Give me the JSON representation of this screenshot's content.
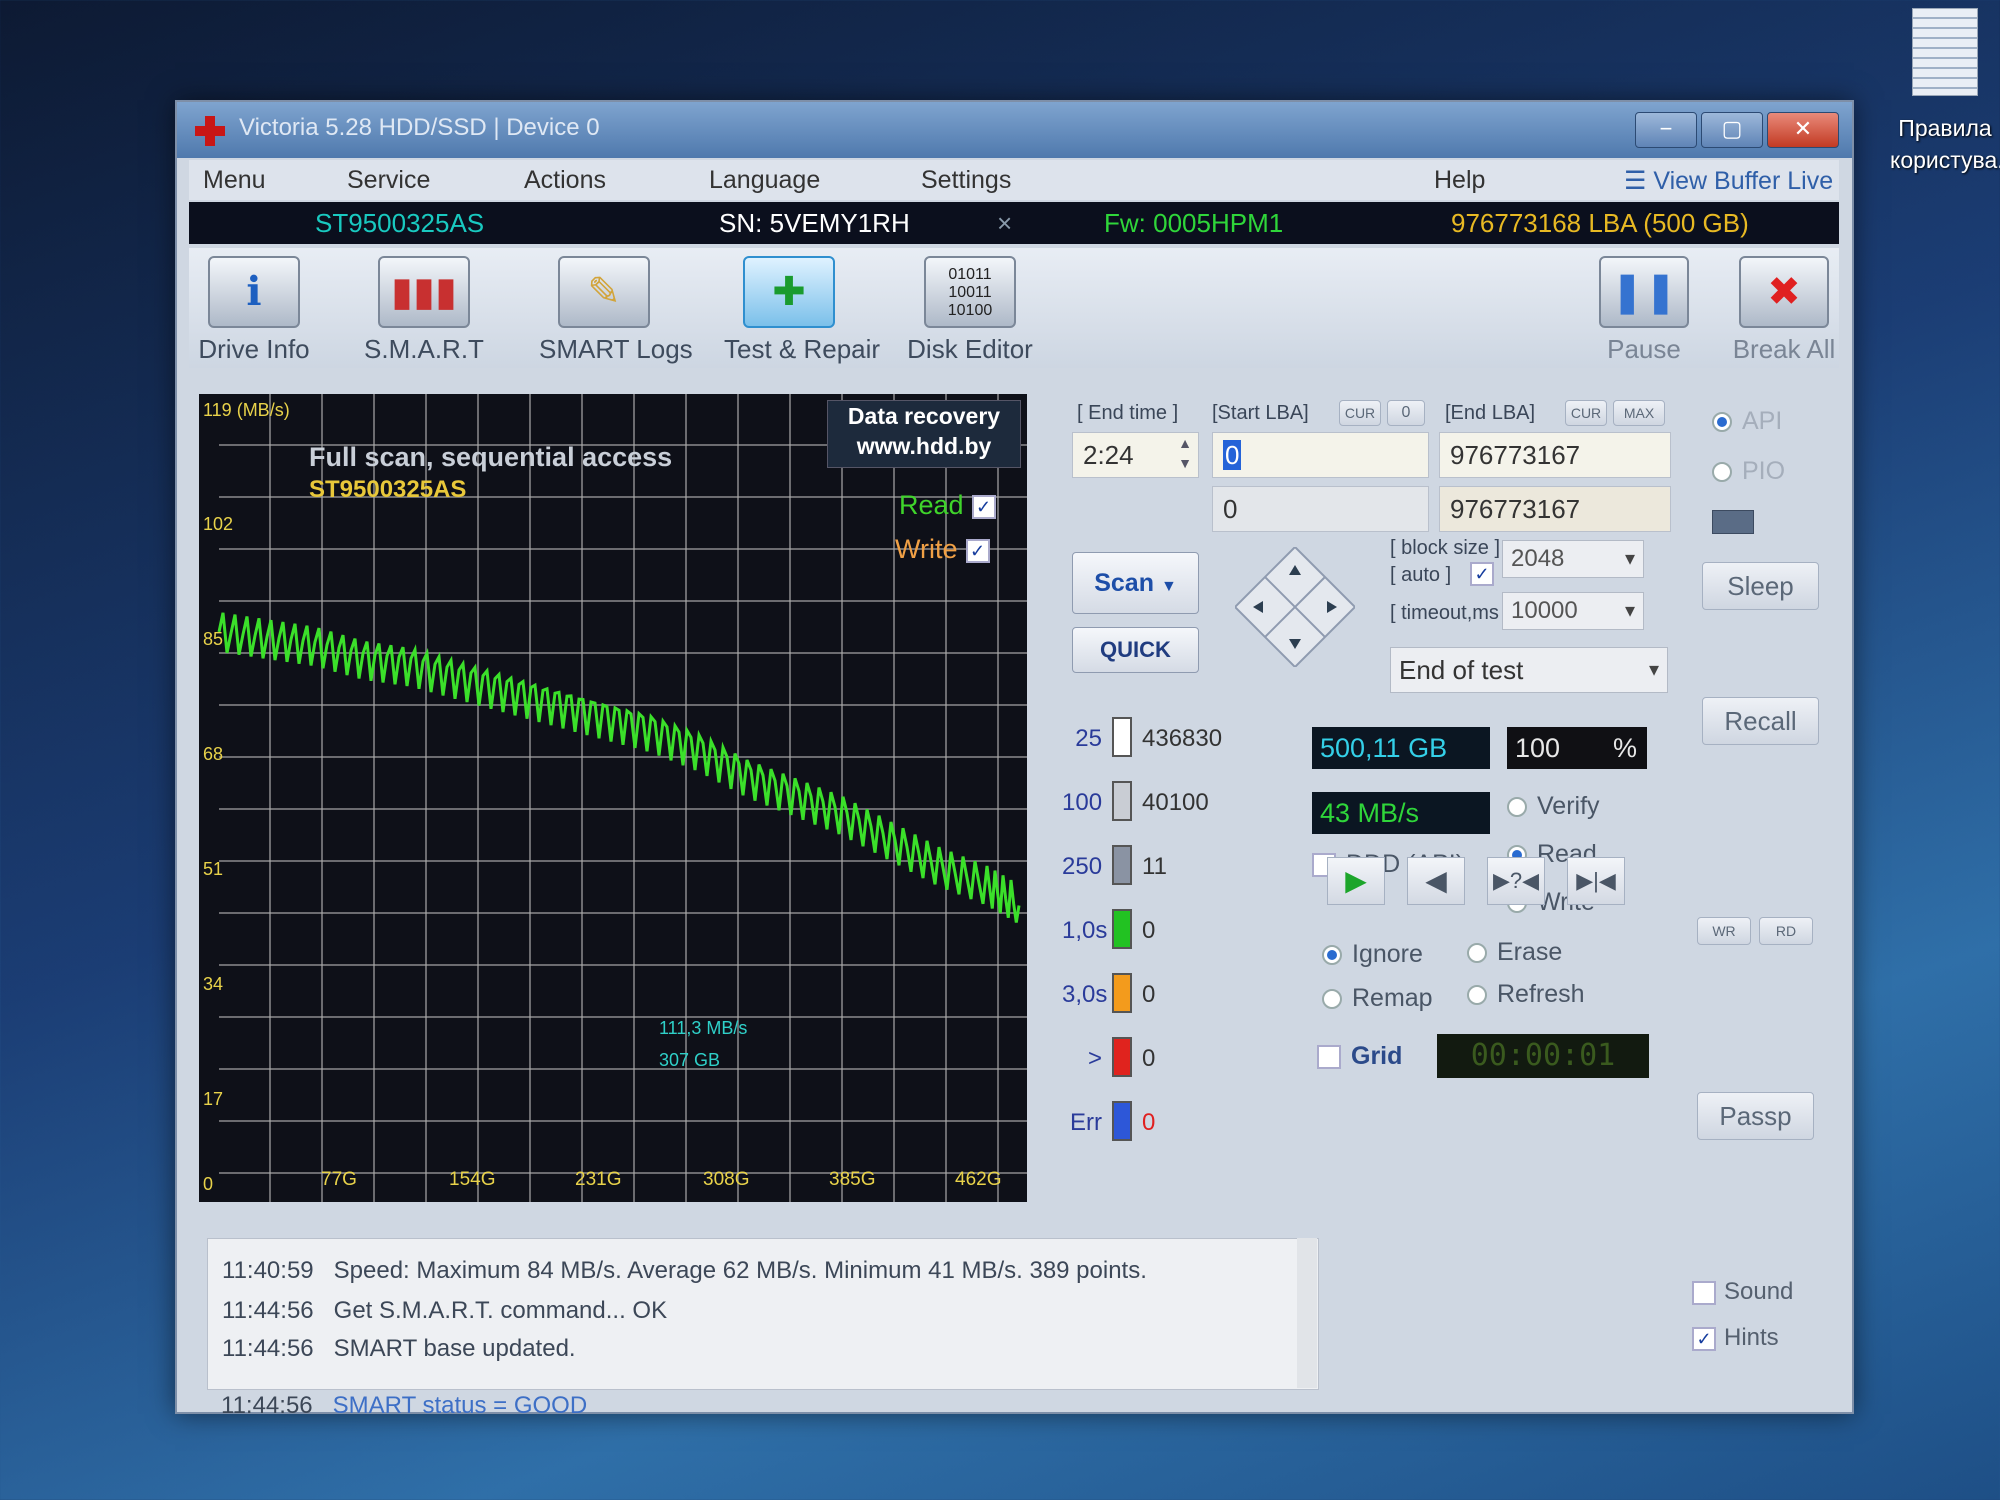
{
  "desktop": {
    "icon_label_1": "Правила",
    "icon_label_2": "користува.."
  },
  "window": {
    "title": "Victoria 5.28 HDD/SSD | Device 0",
    "min": "−",
    "max": "▢",
    "close": "✕"
  },
  "menu": [
    "Menu",
    "Service",
    "Actions",
    "Language",
    "Settings",
    "Help"
  ],
  "view_buffer": "View Buffer Live",
  "device": {
    "model": "ST9500325AS",
    "serial": "SN: 5VEMY1RH",
    "close": "×",
    "firmware": "Fw: 0005HPM1",
    "capacity": "976773168 LBA (500 GB)"
  },
  "toolbar": [
    {
      "label": "Drive Info",
      "icon": "info-icon"
    },
    {
      "label": "S.M.A.R.T",
      "icon": "bars-icon"
    },
    {
      "label": "SMART Logs",
      "icon": "folder-icon"
    },
    {
      "label": "Test & Repair",
      "icon": "medkit-icon"
    },
    {
      "label": "Disk Editor",
      "icon": "binary-icon"
    }
  ],
  "pause": "Pause",
  "break_all": "Break All",
  "graph": {
    "unit": "119 (MB/s)",
    "title": "Full scan, sequential access",
    "model": "ST9500325AS",
    "ad_line1": "Data recovery",
    "ad_line2": "www.hdd.by",
    "read_label": "Read",
    "write_label": "Write",
    "y_ticks": [
      "102",
      "85",
      "68",
      "51",
      "34",
      "17",
      "0"
    ],
    "x_ticks": [
      "77G",
      "154G",
      "231G",
      "308G",
      "385G",
      "462G"
    ],
    "cursor_speed": "111,3 MB/s",
    "cursor_pos": "307 GB"
  },
  "chart_data": {
    "type": "line",
    "ylabel": "119 (MB/s)",
    "ylim": [
      0,
      119
    ],
    "x_ticks": [
      "77G",
      "154G",
      "231G",
      "308G",
      "385G",
      "462G"
    ],
    "series": [
      {
        "name": "Read",
        "x": [
          0,
          30,
          60,
          90,
          120,
          150,
          180,
          210,
          240,
          270,
          300,
          330,
          360,
          390,
          420,
          450,
          480,
          500
        ],
        "values": [
          84,
          83,
          82,
          80,
          79,
          77,
          75,
          73,
          71,
          69,
          66,
          62,
          59,
          56,
          52,
          48,
          45,
          42
        ]
      }
    ]
  },
  "controls": {
    "end_time_label": "[ End time ]",
    "end_time": "2:24",
    "start_lba_label": "[Start LBA]",
    "cur": "CUR",
    "zero": "0",
    "end_lba_label": "[End LBA]",
    "max": "MAX",
    "start_lba": "0",
    "end_lba": "976773167",
    "current_lba": "0",
    "current_end": "976773167",
    "scan": "Scan",
    "quick": "QUICK",
    "block_size_label": "[ block size ]",
    "auto_label": "[ auto ]",
    "timeout_label": "[ timeout,ms ]",
    "block_size": "2048",
    "timeout": "10000",
    "end_action": "End of test"
  },
  "stats": [
    {
      "label": "25",
      "count": "436830",
      "color": "#ffffff"
    },
    {
      "label": "100",
      "count": "40100",
      "color": "#c9cdd4"
    },
    {
      "label": "250",
      "count": "11",
      "color": "#8a93a3"
    },
    {
      "label": "1,0s",
      "count": "0",
      "color": "#22c222"
    },
    {
      "label": "3,0s",
      "count": "0",
      "color": "#f39b1c"
    },
    {
      "label": ">",
      "count": "0",
      "color": "#e0231e"
    },
    {
      "label": "Err",
      "count": "0",
      "color": "#2d57d8"
    }
  ],
  "progress": {
    "size": "500,11 GB",
    "percent": "100",
    "percent_sign": "%",
    "speed": "43 MB/s"
  },
  "mode": {
    "verify": "Verify",
    "read": "Read",
    "write": "Write",
    "ddd": "DDD (API)"
  },
  "repair": {
    "ignore": "Ignore",
    "erase": "Erase",
    "remap": "Remap",
    "refresh": "Refresh"
  },
  "grid_label": "Grid",
  "timer": "00:00:01",
  "side": {
    "api": "API",
    "pio": "PIO",
    "sleep": "Sleep",
    "recall": "Recall",
    "passp": "Passp",
    "wr": "WR",
    "rd": "RD",
    "sound": "Sound",
    "hints": "Hints"
  },
  "log": [
    {
      "time": "11:40:59",
      "msg": "Speed: Maximum 84 MB/s. Average 62 MB/s. Minimum 41 MB/s. 389 points."
    },
    {
      "time": "11:44:56",
      "msg": "Get S.M.A.R.T. command... OK"
    },
    {
      "time": "11:44:56",
      "msg": "SMART base updated."
    },
    {
      "time": "11:44:56",
      "msg": "SMART status = GOOD"
    }
  ]
}
